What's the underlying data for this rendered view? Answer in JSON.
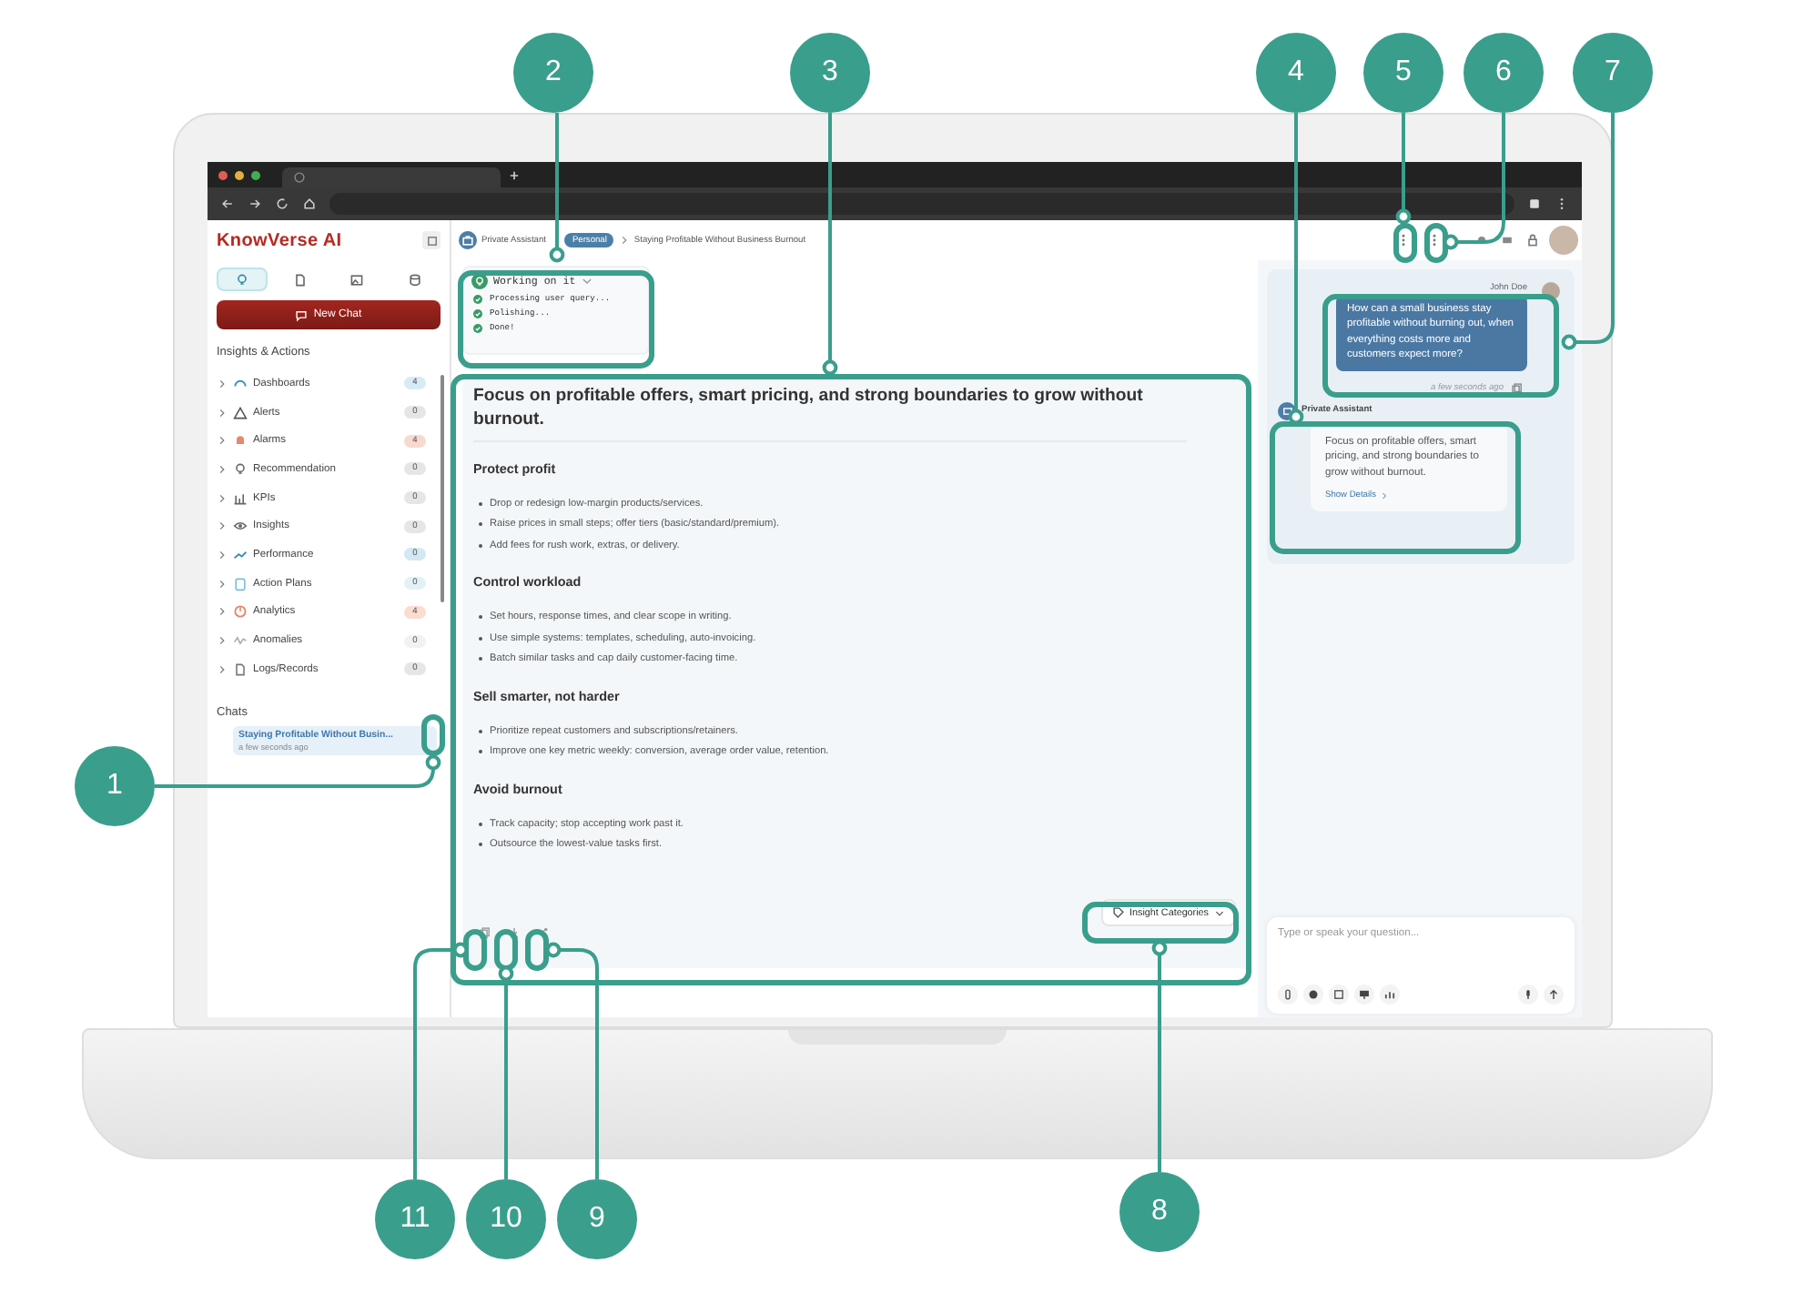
{
  "sidebar": {
    "app_name": "KnowVerse AI",
    "mode_tabs": [
      {
        "selected": true
      },
      {
        "selected": false
      },
      {
        "selected": false
      },
      {
        "selected": false
      }
    ],
    "new_chat": "New Chat",
    "section_title": "Insights & Actions",
    "items": [
      {
        "label": "Dashboards",
        "count": "4",
        "color": "#d6ecf5"
      },
      {
        "label": "Alerts",
        "count": "0",
        "color": "#e6e6e6"
      },
      {
        "label": "Alarms",
        "count": "4",
        "color": "#f8d9cf"
      },
      {
        "label": "Recommendation",
        "count": "0",
        "color": "#e6e6e6"
      },
      {
        "label": "KPIs",
        "count": "0",
        "color": "#e6e6e6"
      },
      {
        "label": "Insights",
        "count": "0",
        "color": "#e6e6e6"
      },
      {
        "label": "Performance",
        "count": "0",
        "color": "#d3e8f3"
      },
      {
        "label": "Action Plans",
        "count": "0",
        "color": "#e2f1f6"
      },
      {
        "label": "Analytics",
        "count": "4",
        "color": "#fbdcd0"
      },
      {
        "label": "Anomalies",
        "count": "0",
        "color": "#f2f2f2"
      },
      {
        "label": "Logs/Records",
        "count": "0",
        "color": "#e6e6e6"
      }
    ],
    "chats_title": "Chats",
    "chats": [
      {
        "title": "Staying Profitable Without Busin...",
        "time": "a few seconds ago",
        "selected": true
      }
    ]
  },
  "header": {
    "assistant": "Private Assistant",
    "badge": "Personal",
    "title": "Staying Profitable Without Business Burnout"
  },
  "status": {
    "title": "Working on it",
    "steps": [
      {
        "label": "Processing user query...",
        "done": true
      },
      {
        "label": "Polishing...",
        "done": true
      },
      {
        "label": "Done!",
        "done": true
      }
    ]
  },
  "answer": {
    "heading": "Focus on profitable offers, smart pricing, and strong boundaries to grow without burnout.",
    "sections": [
      {
        "title": "Protect profit",
        "bullets": [
          "Drop or redesign low-margin products/services.",
          "Raise prices in small steps; offer tiers (basic/standard/premium).",
          "Add fees for rush work, extras, or delivery."
        ]
      },
      {
        "title": "Control workload",
        "bullets": [
          "Set hours, response times, and clear scope in writing.",
          "Use simple systems: templates, scheduling, auto-invoicing.",
          "Batch similar tasks and cap daily customer-facing time."
        ]
      },
      {
        "title": "Sell smarter, not harder",
        "bullets": [
          "Prioritize repeat customers and subscriptions/retainers.",
          "Improve one key metric weekly: conversion, average order value, retention."
        ]
      },
      {
        "title": "Avoid burnout",
        "bullets": [
          "Track capacity; stop accepting work past it.",
          "Outsource the lowest-value tasks first."
        ]
      }
    ],
    "categories_button": "Insight Categories"
  },
  "chat": {
    "user_name": "John Doe",
    "user_message": "How can a small business stay profitable without burning out, when everything costs more and customers expect more?",
    "user_time": "a few seconds ago",
    "assistant_name": "Private Assistant",
    "assistant_message": "Focus on profitable offers, smart pricing, and strong boundaries to grow without burnout.",
    "show_details": "Show Details",
    "input": {
      "placeholder": "Type or speak your question..."
    }
  },
  "callouts": [
    "2",
    "3",
    "4",
    "5",
    "6",
    "7",
    "1",
    "11",
    "10",
    "9",
    "8"
  ]
}
